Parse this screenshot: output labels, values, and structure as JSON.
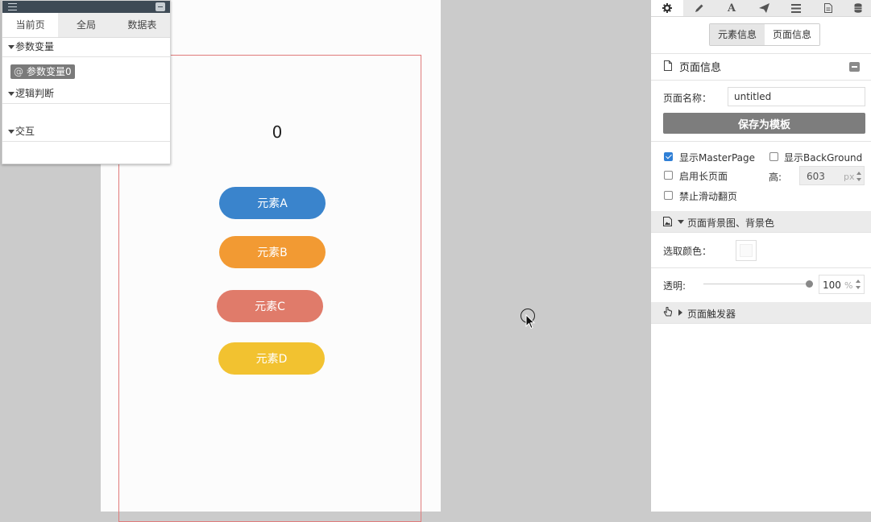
{
  "left_panel": {
    "tabs": [
      "当前页",
      "全局",
      "数据表"
    ],
    "sections": {
      "params": "参数变量",
      "logic": "逻辑判断",
      "interaction": "交互"
    },
    "variable_chip": {
      "symbol": "@",
      "label": "参数变量0"
    }
  },
  "canvas": {
    "counter": "0",
    "elements": [
      {
        "label": "元素A",
        "color": "#3a84cc"
      },
      {
        "label": "元素B",
        "color": "#f29a33"
      },
      {
        "label": "元素C",
        "color": "#e07b6a"
      },
      {
        "label": "元素D",
        "color": "#f2c230"
      }
    ]
  },
  "right_panel": {
    "toolbar_icons": [
      "gear-icon",
      "pencil-icon",
      "font-icon",
      "paper-plane-icon",
      "list-icon",
      "document-icon",
      "database-icon"
    ],
    "segment": {
      "element_info": "元素信息",
      "page_info": "页面信息"
    },
    "section_title": "页面信息",
    "page_name_label": "页面名称：",
    "page_name_value": "untitled",
    "save_template": "保存为模板",
    "checkboxes": {
      "show_master": {
        "label": "显示MasterPage",
        "checked": true
      },
      "show_background": {
        "label": "显示BackGround",
        "checked": false
      },
      "long_page": {
        "label": "启用长页面",
        "checked": false
      },
      "disable_swipe": {
        "label": "禁止滑动翻页",
        "checked": false
      }
    },
    "height_label": "高:",
    "height_value": "603",
    "height_unit": "px",
    "bg_section": "页面背景图、背景色",
    "pick_color_label": "选取颜色：",
    "opacity_label": "透明:",
    "opacity_value": "100",
    "opacity_unit": "%",
    "opacity_level": 1.0,
    "trigger_section": "页面触发器"
  }
}
